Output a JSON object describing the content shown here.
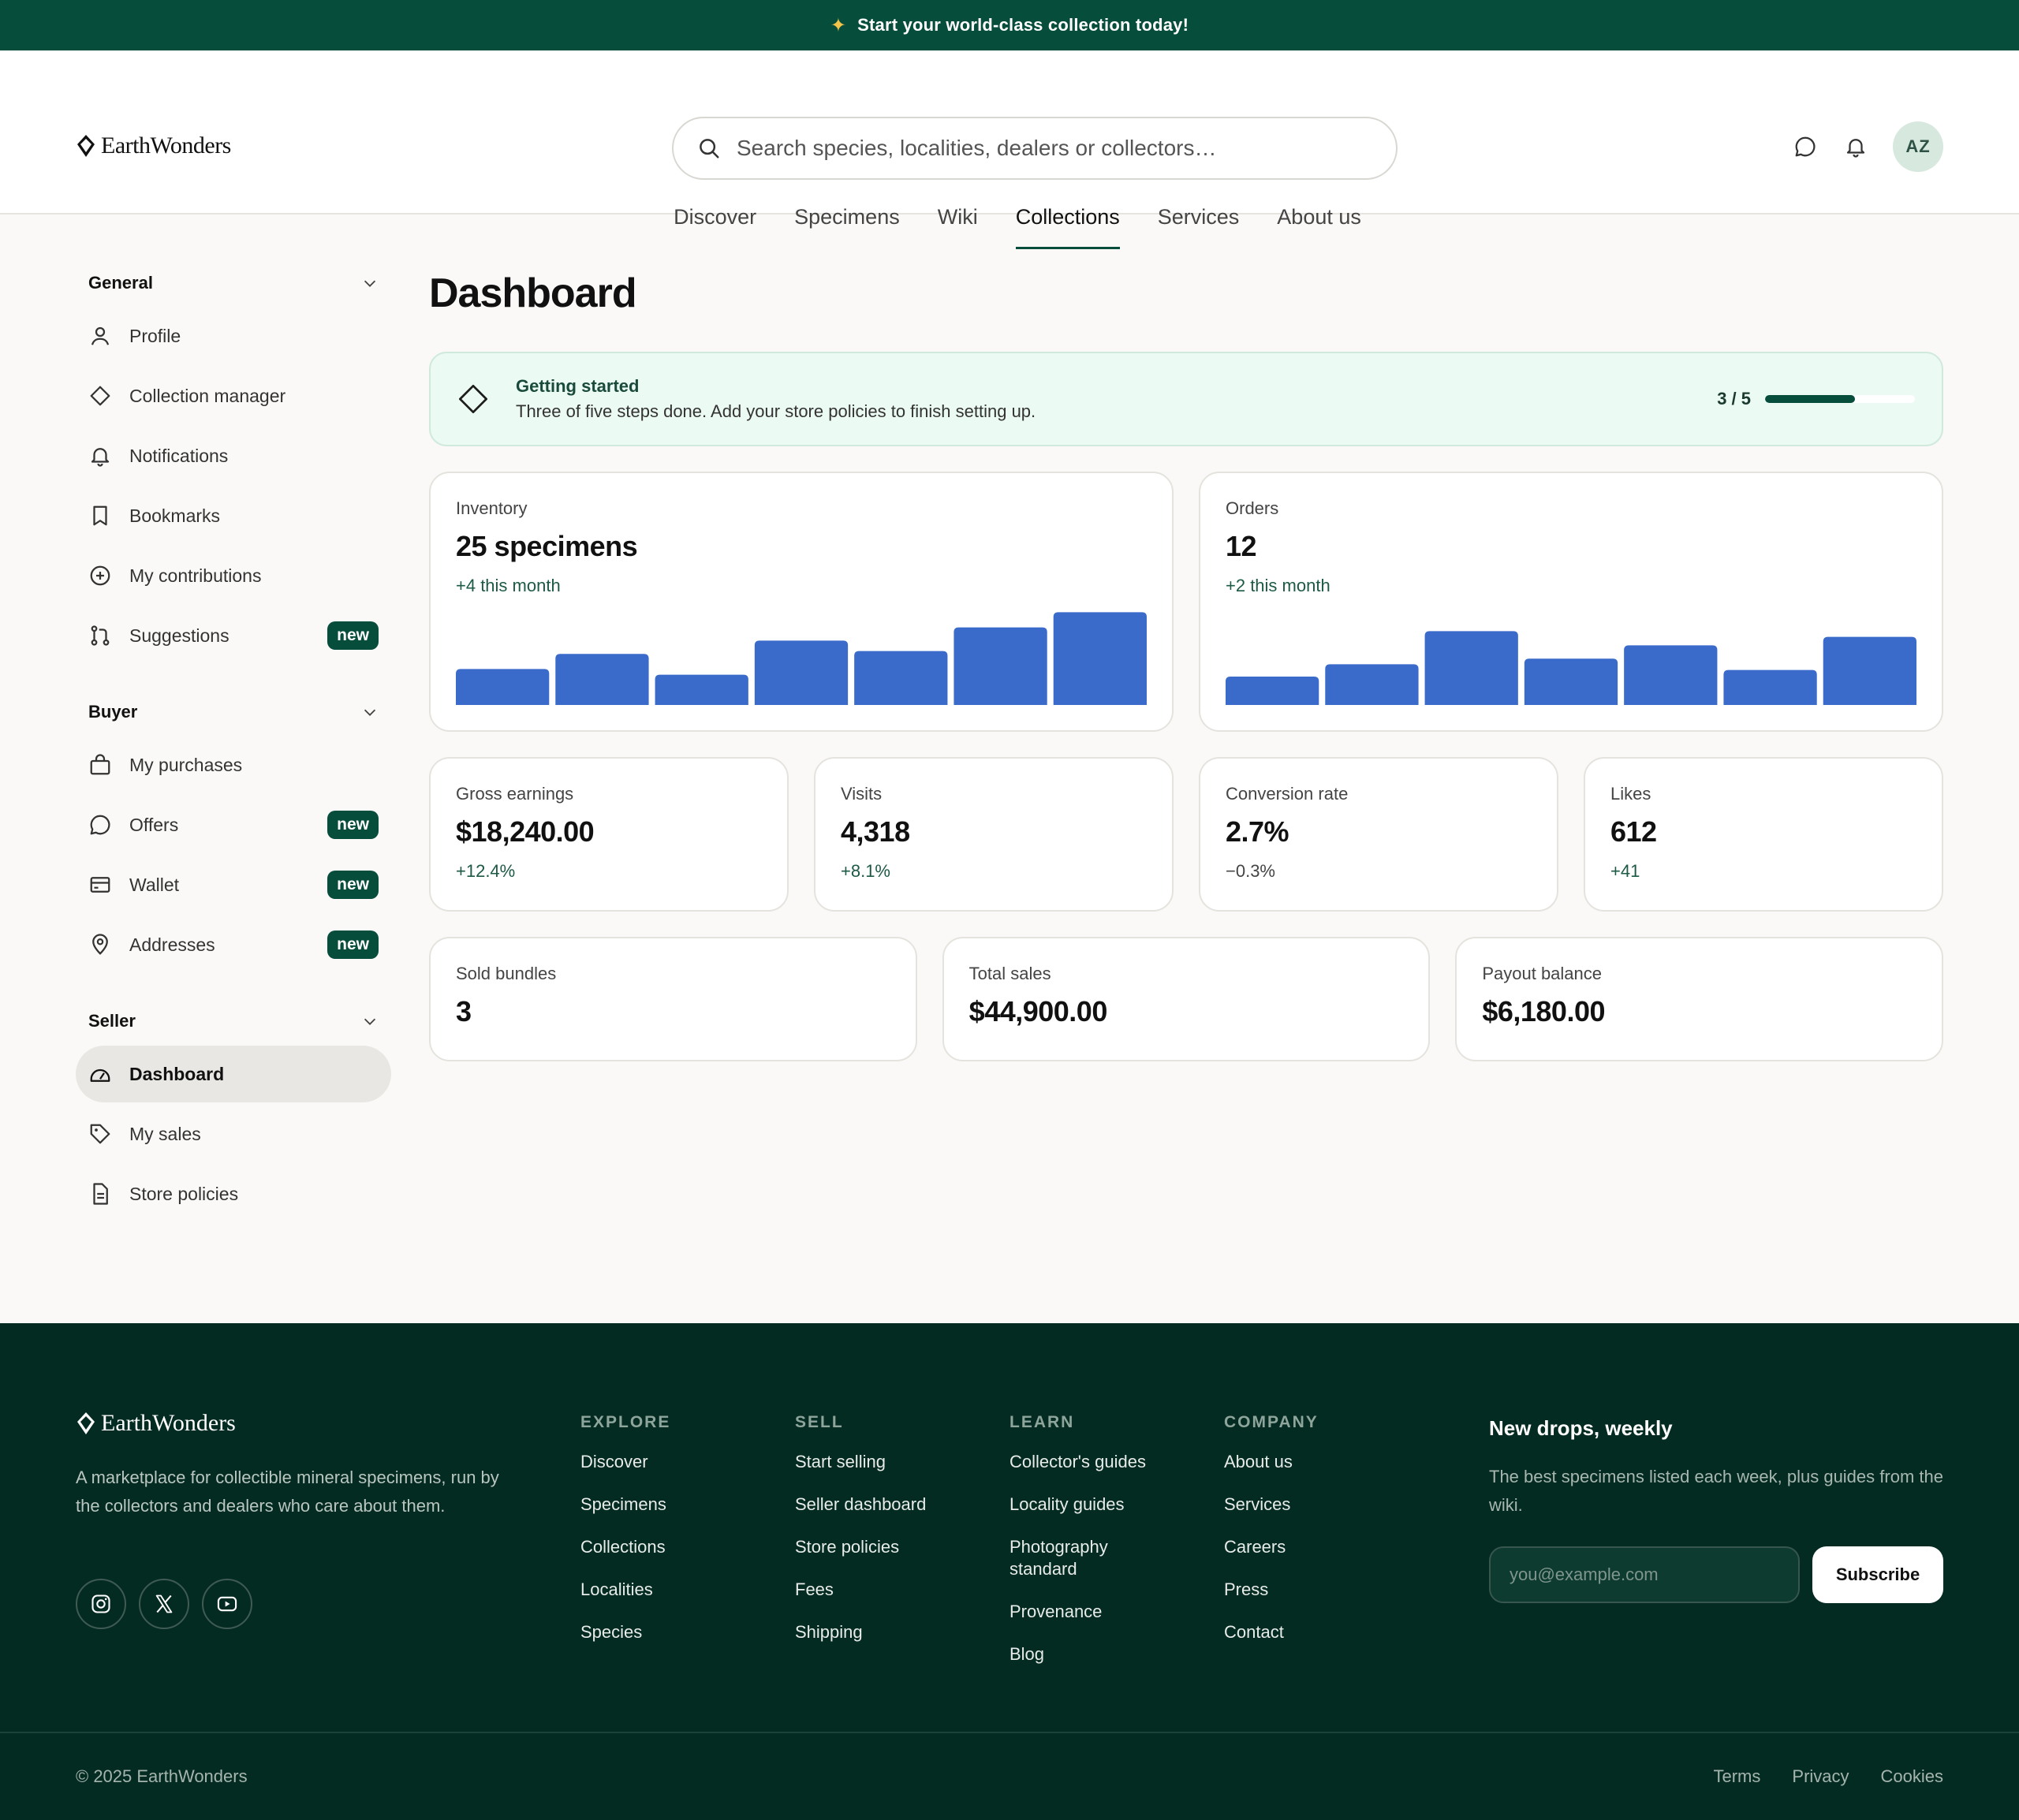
{
  "banner": {
    "text": "Start your world-class collection today!"
  },
  "brand": {
    "name": "EarthWonders"
  },
  "search": {
    "placeholder": "Search species, localities, dealers or collectors…"
  },
  "user": {
    "initials": "AZ"
  },
  "nav": {
    "items": [
      "Discover",
      "Specimens",
      "Wiki",
      "Collections",
      "Services",
      "About us"
    ],
    "active": "Collections"
  },
  "sidebar": {
    "general": {
      "title": "General",
      "items": [
        {
          "label": "Profile",
          "icon": "user-icon"
        },
        {
          "label": "Collection manager",
          "icon": "diamond-icon"
        },
        {
          "label": "Notifications",
          "icon": "bell-icon"
        },
        {
          "label": "Bookmarks",
          "icon": "bookmark-icon"
        },
        {
          "label": "My contributions",
          "icon": "plus-circle-icon"
        },
        {
          "label": "Suggestions",
          "icon": "git-pull-icon",
          "badge": "new"
        }
      ]
    },
    "buyer": {
      "title": "Buyer",
      "items": [
        {
          "label": "My purchases",
          "icon": "bag-icon"
        },
        {
          "label": "Offers",
          "icon": "chat-icon",
          "badge": "new"
        },
        {
          "label": "Wallet",
          "icon": "wallet-icon",
          "badge": "new"
        },
        {
          "label": "Addresses",
          "icon": "pin-icon",
          "badge": "new"
        }
      ]
    },
    "seller": {
      "title": "Seller",
      "items": [
        {
          "label": "Dashboard",
          "icon": "gauge-icon"
        },
        {
          "label": "My sales",
          "icon": "tag-icon"
        },
        {
          "label": "Store policies",
          "icon": "document-icon"
        }
      ]
    }
  },
  "dashboard": {
    "title": "Dashboard",
    "getting_started": {
      "title": "Getting started",
      "description": "Three of five steps done. Add your store policies to finish setting up.",
      "progress_label": "3 / 5",
      "progress_fraction": 0.6
    },
    "inventory": {
      "label": "Inventory",
      "value": "25 specimens",
      "delta": "+4 this month"
    },
    "orders": {
      "label": "Orders",
      "value": "12",
      "delta": "+2 this month"
    },
    "stats": [
      {
        "label": "Gross earnings",
        "value": "$18,240.00",
        "delta": "+12.4%"
      },
      {
        "label": "Visits",
        "value": "4,318",
        "delta": "+8.1%"
      },
      {
        "label": "Conversion rate",
        "value": "2.7%",
        "delta": "−0.3%"
      },
      {
        "label": "Likes",
        "value": "612",
        "delta": "+41"
      }
    ],
    "totals": [
      {
        "label": "Sold bundles",
        "value": "3"
      },
      {
        "label": "Total sales",
        "value": "$44,900.00"
      },
      {
        "label": "Payout balance",
        "value": "$6,180.00"
      }
    ]
  },
  "chart_data": [
    {
      "type": "bar",
      "values": [
        38,
        54,
        32,
        68,
        57,
        82,
        98
      ],
      "ylim": [
        0,
        100
      ],
      "color": "#3b6bca"
    },
    {
      "type": "bar",
      "values": [
        30,
        43,
        78,
        49,
        63,
        37,
        72
      ],
      "ylim": [
        0,
        100
      ],
      "color": "#3b6bca"
    }
  ],
  "footer": {
    "description": "A marketplace for collectible mineral specimens, run by the collectors and dealers who care about them.",
    "columns": [
      {
        "title": "EXPLORE",
        "links": [
          "Discover",
          "Specimens",
          "Collections",
          "Localities",
          "Species"
        ]
      },
      {
        "title": "SELL",
        "links": [
          "Start selling",
          "Seller dashboard",
          "Store policies",
          "Fees",
          "Shipping"
        ]
      },
      {
        "title": "LEARN",
        "links": [
          "Collector's guides",
          "Locality guides",
          "Photography standard",
          "Provenance",
          "Blog"
        ]
      },
      {
        "title": "COMPANY",
        "links": [
          "About us",
          "Services",
          "Careers",
          "Press",
          "Contact"
        ]
      }
    ],
    "newsletter": {
      "title": "New drops, weekly",
      "description": "The best specimens listed each week, plus guides from the wiki.",
      "placeholder": "you@example.com",
      "button": "Subscribe"
    },
    "copyright": "© 2025 EarthWonders",
    "legal": [
      "Terms",
      "Privacy",
      "Cookies"
    ]
  },
  "colors": {
    "brand": "#074d3c",
    "accent_bar": "#3b6bca",
    "footer_bg": "#042b22"
  }
}
